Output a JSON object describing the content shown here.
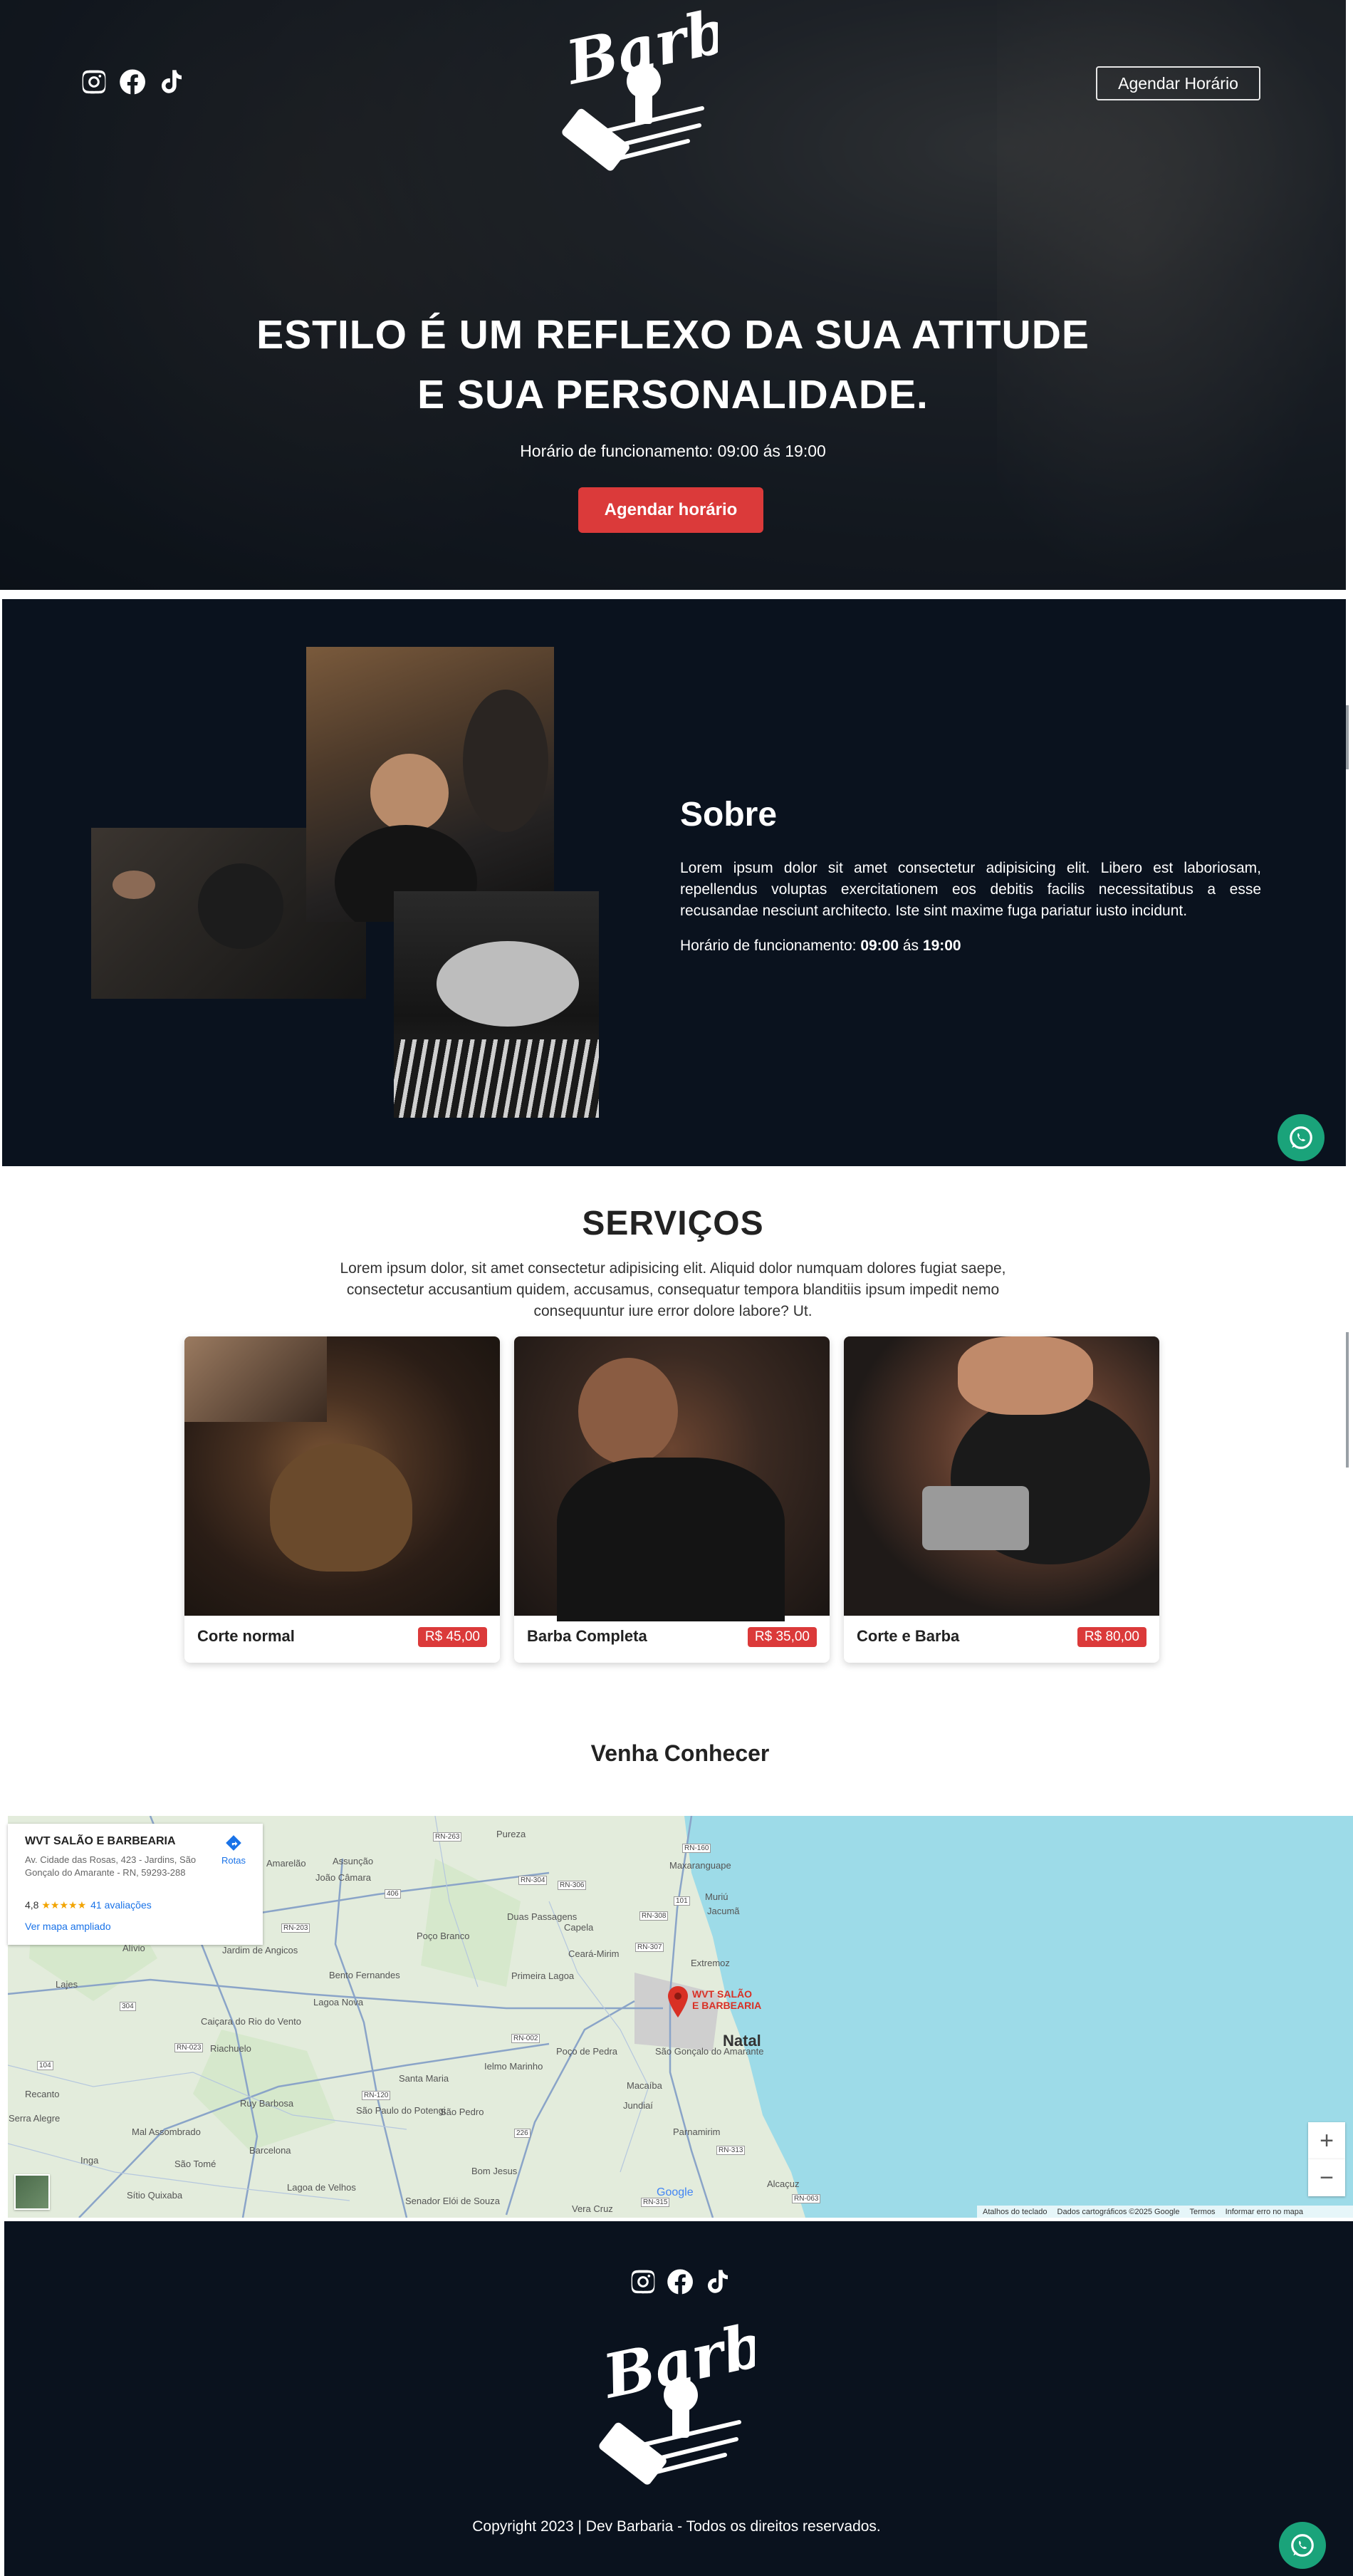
{
  "hero": {
    "social": [
      "instagram-icon",
      "facebook-icon",
      "tiktok-icon"
    ],
    "logo_text": "Barber",
    "cta_outline_label": "Agendar Horário",
    "title_line1": "ESTILO É UM REFLEXO DA SUA ATITUDE",
    "title_line2": "E SUA PERSONALIDADE.",
    "hours": "Horário de funcionamento: 09:00 ás 19:00",
    "cta_label": "Agendar horário"
  },
  "sobre": {
    "title": "Sobre",
    "text": "Lorem ipsum dolor sit amet consectetur adipisicing elit. Libero est laboriosam, repellendus voluptas exercitationem eos debitis facilis necessitatibus a esse recusandae nesciunt architecto. Iste sint maxime fuga pariatur iusto incidunt.",
    "hours_prefix": "Horário de funcionamento: ",
    "hours_open": "09:00",
    "hours_mid": " ás ",
    "hours_close": "19:00"
  },
  "servicos": {
    "title": "SERVIÇOS",
    "text": "Lorem ipsum dolor, sit amet consectetur adipisicing elit. Aliquid dolor numquam dolores fugiat saepe, consectetur accusantium quidem, accusamus, consequatur tempora blanditiis ipsum impedit nemo consequuntur iure error dolore labore? Ut.",
    "cards": [
      {
        "name": "Corte normal",
        "price": "R$ 45,00"
      },
      {
        "name": "Barba Completa",
        "price": "R$ 35,00"
      },
      {
        "name": "Corte e Barba",
        "price": "R$ 80,00"
      }
    ]
  },
  "conhecer": {
    "title": "Venha Conhecer"
  },
  "map": {
    "place_name": "WVT SALÃO E BARBEARIA",
    "address": "Av. Cidade das Rosas, 423 - Jardins, São Gonçalo do Amarante - RN, 59293-288",
    "rating": "4,8",
    "stars": "★★★★★",
    "reviews": "41 avaliações",
    "larger_map": "Ver mapa ampliado",
    "directions": "Rotas",
    "pin_label_1": "WVT SALÃO",
    "pin_label_2": "E BARBEARIA",
    "zoom_in": "+",
    "zoom_out": "−",
    "google": "Google",
    "footer_links": [
      "Atalhos do teclado",
      "Dados cartográficos ©2025 Google",
      "Termos",
      "Informar erro no mapa"
    ],
    "cities": [
      "Pureza",
      "Maxaranguape",
      "Muriú",
      "Jacumã",
      "Amarelão",
      "Assunção",
      "João Câmara",
      "Duas Passagens",
      "Capela",
      "Poço Branco",
      "Ceará-Mirim",
      "Extremoz",
      "Jardim de Angicos",
      "Bento Fernandes",
      "Lagoa Nova",
      "Primeira Lagoa",
      "Lajes",
      "Caiçara do Rio do Vento",
      "Riachuelo",
      "Poço de Pedra",
      "São Gonçalo do Amarante",
      "Natal",
      "Santa Maria",
      "Ielmo Marinho",
      "Macaíba",
      "Ruy Barbosa",
      "São Paulo do Potengi",
      "São Pedro",
      "Jundiaí",
      "Parnamirim",
      "Recanto",
      "Mal Assombrado",
      "Barcelona",
      "Inga",
      "São Tomé",
      "Sítio Quixaba",
      "Lagoa de Velhos",
      "Senador Elói de Souza",
      "Bom Jesus",
      "Vera Cruz",
      "Alcaçuz",
      "Alívio",
      "Serra Alegre"
    ],
    "highways": [
      "RN-263",
      "RN-160",
      "RN-203",
      "RN-306",
      "RN-308",
      "RN-307",
      "RN-304",
      "RN-023",
      "RN-120",
      "RN-002",
      "RN-315",
      "RN-313",
      "RN-063",
      "406",
      "304",
      "101",
      "226",
      "104"
    ]
  },
  "footer": {
    "logo_text": "Barber",
    "copyright": "Copyright 2023 | Dev Barbaria - Todos os direitos reservados."
  },
  "colors": {
    "accent": "#db3a3a",
    "dark": "#0a121e",
    "whatsapp": "#1aa37a"
  }
}
